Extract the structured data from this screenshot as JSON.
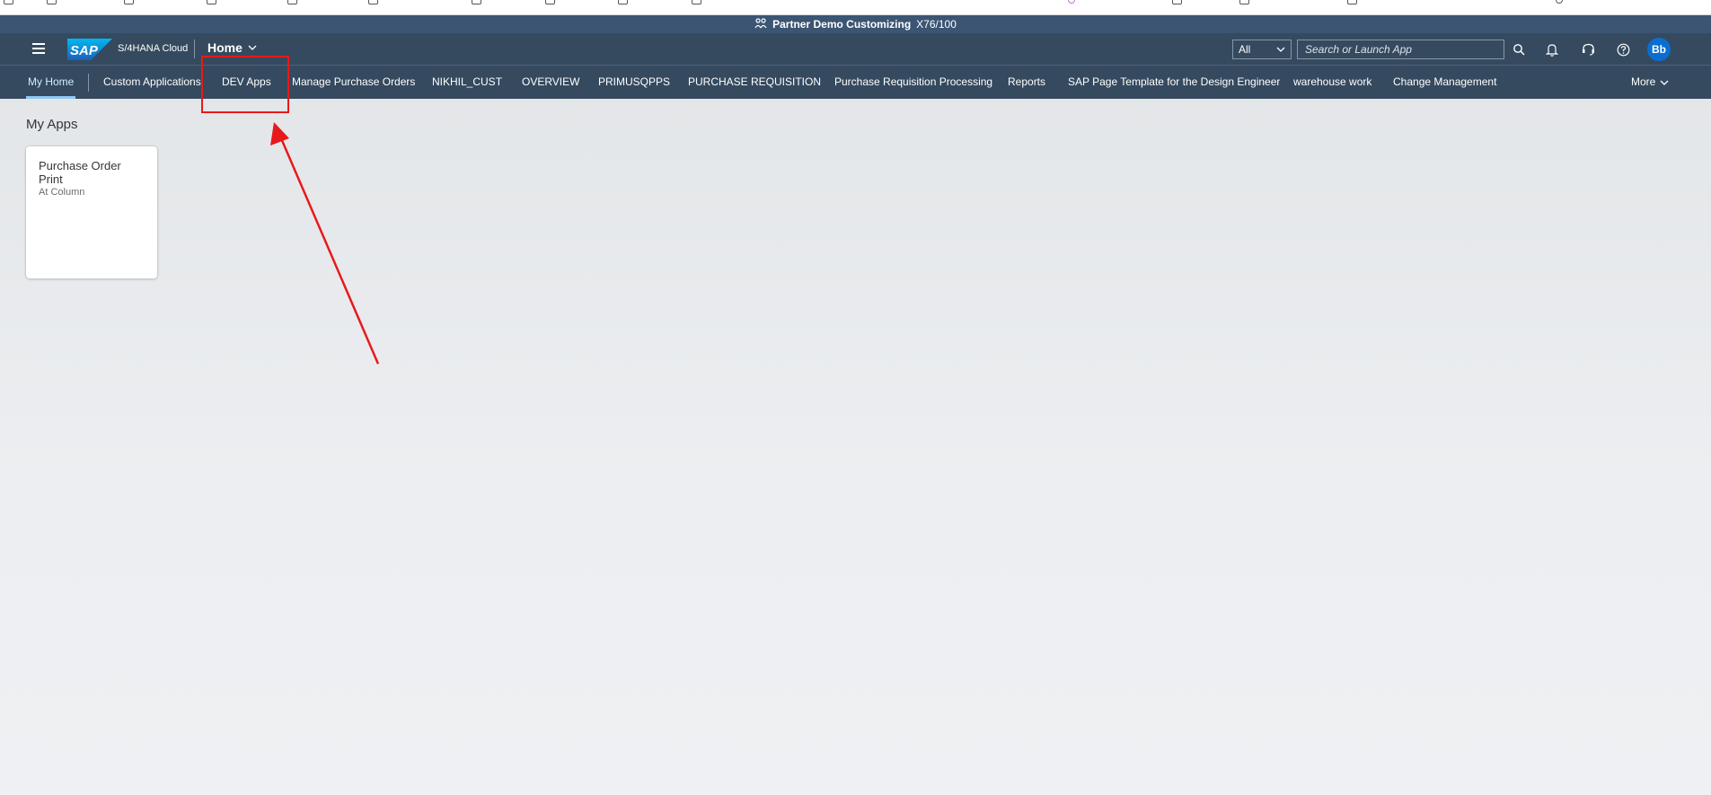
{
  "system_bar": {
    "system_name": "Partner Demo Customizing",
    "client": "X76/100"
  },
  "shell": {
    "product_name": "S/4HANA Cloud",
    "logo_text": "SAP",
    "home_label": "Home",
    "search_scope": "All",
    "search_placeholder": "Search or Launch App",
    "avatar_initials": "Bb",
    "icons": [
      "menu-icon",
      "search-icon",
      "bell-icon",
      "support-icon",
      "help-icon"
    ]
  },
  "nav": {
    "tabs": [
      {
        "label": "My Home",
        "active": true
      },
      {
        "label": "Custom Applications"
      },
      {
        "label": "DEV Apps"
      },
      {
        "label": "Manage Purchase Orders"
      },
      {
        "label": "NIKHIL_CUST"
      },
      {
        "label": "OVERVIEW"
      },
      {
        "label": "PRIMUSQPPS"
      },
      {
        "label": "PURCHASE REQUISITION"
      },
      {
        "label": "Purchase Requisition Processing"
      },
      {
        "label": "Reports"
      },
      {
        "label": "SAP Page Template for the Design Engineer"
      },
      {
        "label": "warehouse work"
      },
      {
        "label": "Change Management"
      }
    ],
    "more_label": "More"
  },
  "main": {
    "section_title": "My Apps",
    "tiles": [
      {
        "title": "Purchase Order Print",
        "subtitle": "At Column"
      }
    ]
  },
  "colors": {
    "shell": "#354a5f",
    "system_bar": "#3b5573",
    "accent": "#0a6ed1",
    "annotation": "#e8191b"
  }
}
